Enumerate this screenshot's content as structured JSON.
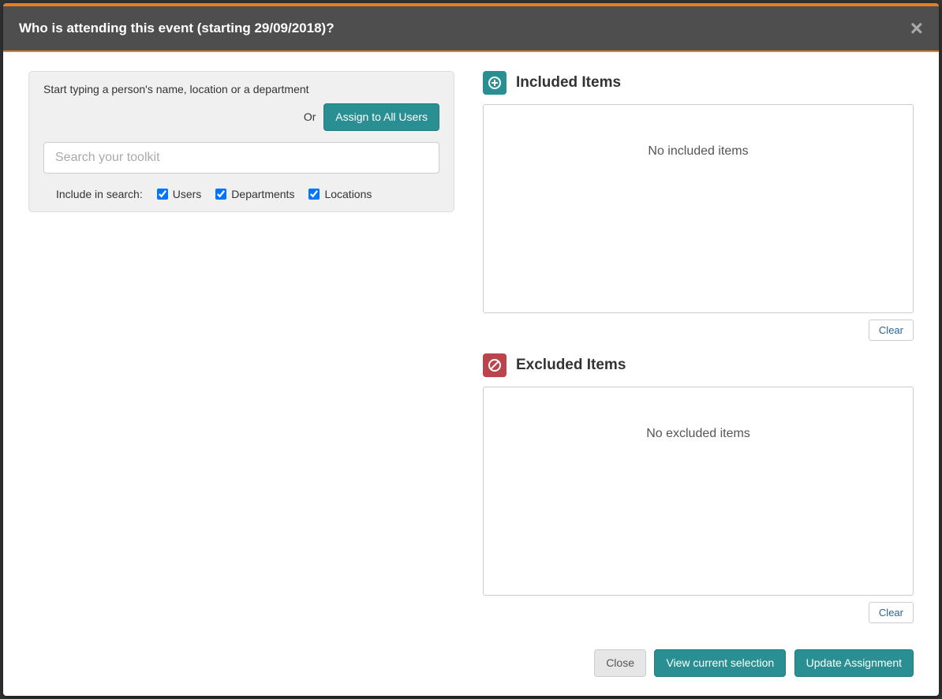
{
  "modal": {
    "title": "Who is attending this event (starting 29/09/2018)?"
  },
  "search": {
    "instruction": "Start typing a person's name, location or a department",
    "orLabel": "Or",
    "assignAllLabel": "Assign to All Users",
    "placeholder": "Search your toolkit",
    "includeLabel": "Include in search:",
    "filterUsers": "Users",
    "filterDepartments": "Departments",
    "filterLocations": "Locations"
  },
  "included": {
    "title": "Included Items",
    "empty": "No included items",
    "clearLabel": "Clear"
  },
  "excluded": {
    "title": "Excluded Items",
    "empty": "No excluded items",
    "clearLabel": "Clear"
  },
  "footer": {
    "close": "Close",
    "view": "View current selection",
    "update": "Update Assignment"
  }
}
